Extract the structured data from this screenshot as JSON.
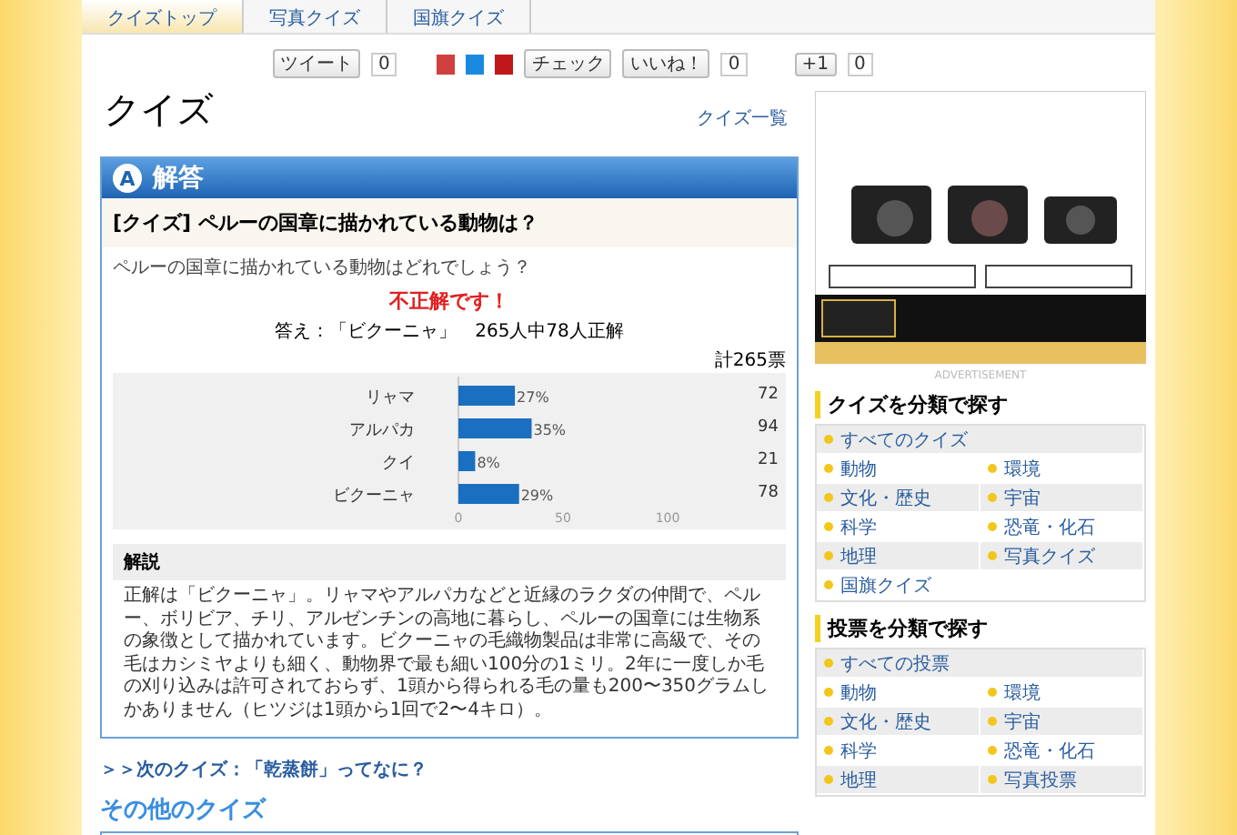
{
  "nav": {
    "tabs": [
      {
        "label": "クイズトップ",
        "selected": true
      },
      {
        "label": "写真クイズ",
        "selected": false
      },
      {
        "label": "国旗クイズ",
        "selected": false
      }
    ]
  },
  "social": {
    "tweet": {
      "label": "ツイート",
      "count": "0"
    },
    "check": {
      "label": "チェック"
    },
    "like": {
      "label": "いいね！",
      "count": "0"
    },
    "plusone": {
      "label": "+1",
      "count": "0"
    }
  },
  "page": {
    "title": "クイズ",
    "list_link": "クイズ一覧"
  },
  "answer": {
    "badge": "A",
    "heading": "解答",
    "question_title": "[クイズ] ペルーの国章に描かれている動物は？",
    "question": "ペルーの国章に描かれている動物はどれでしょう？",
    "result": "不正解です！",
    "answer_line": "答え：「ビクーニャ」　265人中78人正解",
    "total": "計265票",
    "chart_data": {
      "type": "bar",
      "orientation": "horizontal",
      "categories": [
        "リャマ",
        "アルパカ",
        "クイ",
        "ビクーニャ"
      ],
      "values": [
        27,
        35,
        8,
        29
      ],
      "xlim": [
        0,
        100
      ],
      "xticks": [
        0,
        50,
        100
      ],
      "data_labels": true,
      "value_labels": [
        "27%",
        "35%",
        "8%",
        "29%"
      ],
      "color": "#1a6fc0"
    },
    "counts": [
      "72",
      "94",
      "21",
      "78"
    ],
    "explanation_title": "解説",
    "explanation": "正解は「ビクーニャ」。リャマやアルパカなどと近縁のラクダの仲間で、ペルー、ボリビア、チリ、アルゼンチンの高地に暮らし、ペルーの国章には生物系の象徴として描かれています。ビクーニャの毛織物製品は非常に高級で、その毛はカシミヤよりも細く、動物界で最も細い100分の1ミリ。2年に一度しか毛の刈り込みは許可されておらず、1頭から得られる毛の量も200〜350グラムしかありません（ヒツジは1頭から1回で2〜4キロ）。"
  },
  "next_link": "＞＞次のクイズ：「乾蒸餅」ってなに？",
  "other_heading": "その他のクイズ",
  "sidebar": {
    "ad": {
      "kind": "picture",
      "label": "ADVERTISEMENT"
    },
    "sections": [
      {
        "title": "クイズを分類で探す",
        "all": "すべてのクイズ",
        "items": [
          "動物",
          "環境",
          "文化・歴史",
          "宇宙",
          "科学",
          "恐竜・化石",
          "地理",
          "写真クイズ",
          "国旗クイズ"
        ]
      },
      {
        "title": "投票を分類で探す",
        "all": "すべての投票",
        "items": [
          "動物",
          "環境",
          "文化・歴史",
          "宇宙",
          "科学",
          "恐竜・化石",
          "地理",
          "写真投票"
        ]
      }
    ]
  }
}
